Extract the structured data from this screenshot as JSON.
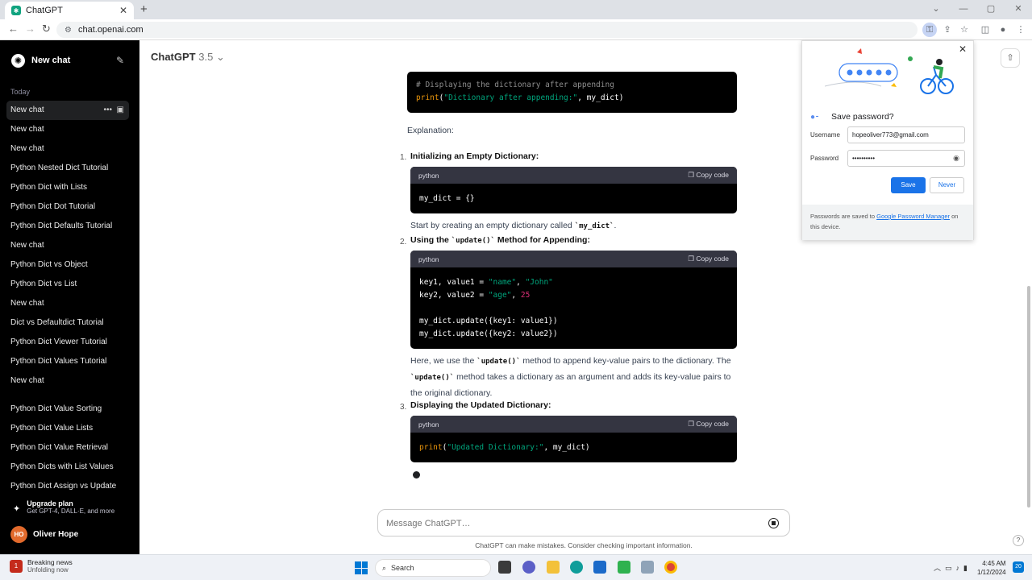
{
  "browser": {
    "tab_title": "ChatGPT",
    "url": "chat.openai.com"
  },
  "sidebar": {
    "new_chat": "New chat",
    "today_label": "Today",
    "items": [
      "New chat",
      "New chat",
      "New chat",
      "Python Nested Dict Tutorial",
      "Python Dict with Lists",
      "Python Dict Dot Tutorial",
      "Python Dict Defaults Tutorial",
      "New chat",
      "Python Dict vs Object",
      "Python Dict vs List",
      "New chat",
      "Dict vs Defaultdict Tutorial",
      "Python Dict Viewer Tutorial",
      "Python Dict Values Tutorial",
      "New chat"
    ],
    "items2": [
      "Python Dict Value Sorting",
      "Python Dict Value Lists",
      "Python Dict Value Retrieval",
      "Python Dicts with List Values",
      "Python Dict Assign vs Update"
    ],
    "upgrade_title": "Upgrade plan",
    "upgrade_sub": "Get GPT-4, DALL·E, and more",
    "user_initials": "HO",
    "user_name": "Oliver Hope"
  },
  "main": {
    "model_name": "ChatGPT",
    "model_version": "3.5",
    "explanation": "Explanation:",
    "code_lang": "python",
    "copy_label": "Copy code",
    "steps": [
      {
        "num": "1.",
        "title": "Initializing an Empty Dictionary:"
      },
      {
        "num": "2.",
        "title_pre": "Using the ",
        "title_code": "`update()`",
        "title_post": " Method for Appending:"
      },
      {
        "num": "3.",
        "title": "Displaying the Updated Dictionary:"
      }
    ],
    "step1_desc_pre": "Start by creating an empty dictionary called ",
    "step1_desc_code": "`my_dict`",
    "step1_desc_post": ".",
    "step2_desc_a": "Here, we use the ",
    "step2_desc_code1": "`update()`",
    "step2_desc_b": " method to append key-value pairs to the dictionary. The",
    "step2_desc_code2": "`update()`",
    "step2_desc_c": " method takes a dictionary as an argument and adds its key-value pairs to",
    "step2_desc_d": "the original dictionary.",
    "input_placeholder": "Message ChatGPT…",
    "disclaimer": "ChatGPT can make mistakes. Consider checking important information.",
    "help": "?"
  },
  "code": {
    "top_comment": "# Displaying the dictionary after appending",
    "top_fn": "print",
    "top_str": "\"Dictionary after appending:\"",
    "top_rest": ", my_dict)",
    "c1": "my_dict = {}",
    "c2_l1_a": "key1, value1 = ",
    "c2_l1_s1": "\"name\"",
    "c2_l1_b": ", ",
    "c2_l1_s2": "\"John\"",
    "c2_l2_a": "key2, value2 = ",
    "c2_l2_s1": "\"age\"",
    "c2_l2_b": ", ",
    "c2_l2_n": "25",
    "c2_l3": "my_dict.update({key1: value1})",
    "c2_l4": "my_dict.update({key2: value2})",
    "c3_fn": "print",
    "c3_str": "\"Updated Dictionary:\"",
    "c3_rest": ", my_dict)"
  },
  "password_popup": {
    "title": "Save password?",
    "username_label": "Username",
    "username_value": "hopeoliver773@gmail.com",
    "password_label": "Password",
    "password_value": "••••••••••",
    "save": "Save",
    "never": "Never",
    "footer_pre": "Passwords are saved to ",
    "footer_link": "Google Password Manager",
    "footer_post": " on this device."
  },
  "taskbar": {
    "news_title": "Breaking news",
    "news_sub": "Unfolding now",
    "news_badge": "1",
    "search": "Search",
    "time": "4:45 AM",
    "date": "1/12/2024",
    "notif_count": "20"
  },
  "colors": {
    "sidebar_bg": "#000000",
    "code_header": "#343541",
    "save_button": "#1a73e8",
    "avatar": "#e26a2c"
  }
}
